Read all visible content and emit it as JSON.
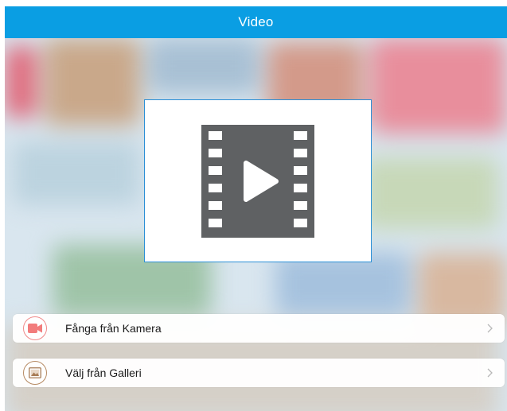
{
  "header": {
    "title": "Video"
  },
  "preview": {
    "icon": "film-play-icon"
  },
  "actions": [
    {
      "label": "Fånga från Kamera",
      "icon": "video-camera-icon",
      "icon_color": "#f27c7c"
    },
    {
      "label": "Välj från Galleri",
      "icon": "gallery-image-icon",
      "icon_color": "#a77b55"
    }
  ],
  "colors": {
    "header_bg": "#0a9ee3",
    "preview_border": "#2a8fd6",
    "film_icon": "#5f6163",
    "chevron": "#b8b8b8"
  }
}
